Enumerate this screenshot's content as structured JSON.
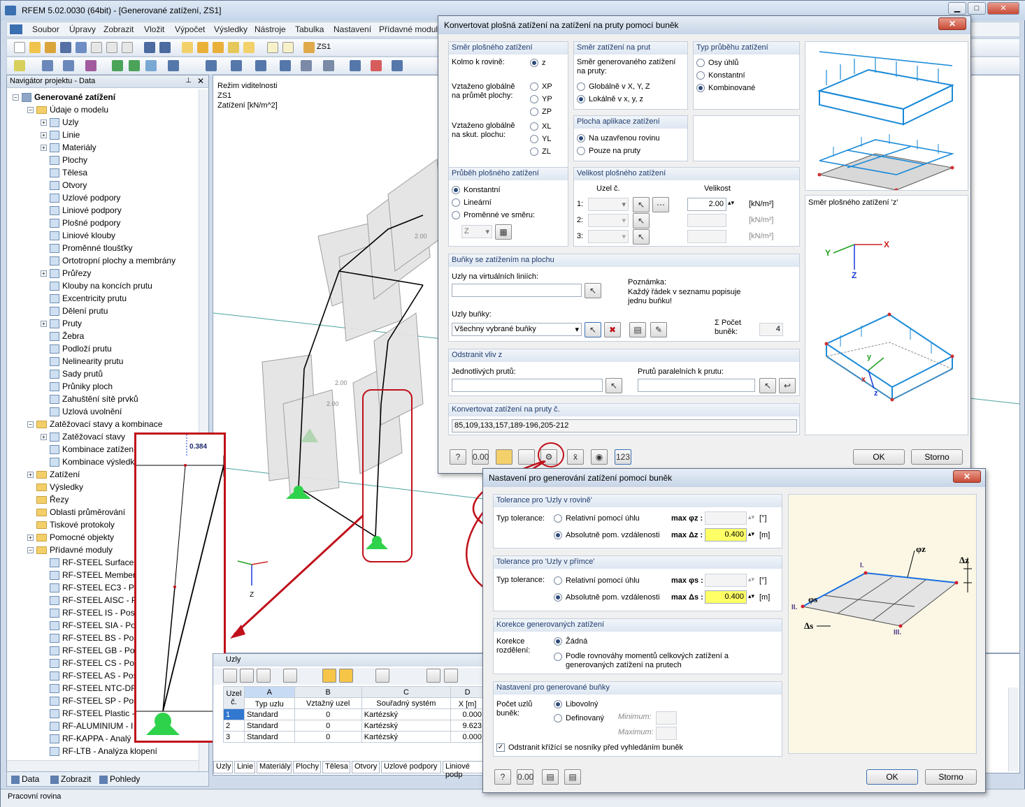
{
  "app": {
    "title": "RFEM 5.02.0030 (64bit) - [Generované zatížení, ZS1]"
  },
  "menu": [
    "Soubor",
    "Úpravy",
    "Zobrazit",
    "Vložit",
    "Výpočet",
    "Výsledky",
    "Nástroje",
    "Tabulka",
    "Nastavení",
    "Přídavné moduly"
  ],
  "toolbar": {
    "loadcase": "ZS1"
  },
  "navigator": {
    "title": "Navigátor projektu - Data",
    "root": "Generované zatížení",
    "items": [
      "Údaje o modelu",
      "Uzly",
      "Linie",
      "Materiály",
      "Plochy",
      "Tělesa",
      "Otvory",
      "Uzlové podpory",
      "Liniové podpory",
      "Plošné podpory",
      "Liniové klouby",
      "Proměnné tloušťky",
      "Ortotropní plochy a membrány",
      "Průřezy",
      "Klouby na koncích prutu",
      "Excentricity prutu",
      "Dělení prutu",
      "Pruty",
      "Žebra",
      "Podloží prutu",
      "Nelinearity prutu",
      "Sady prutů",
      "Průniky ploch",
      "Zahuštění sítě prvků",
      "Uzlová uvolnění",
      "Zatěžovací stavy a kombinace",
      "Zatěžovací stavy",
      "Kombinace zatížení",
      "Kombinace výsledků",
      "Zatížení",
      "Výsledky",
      "Řezy",
      "Oblasti průměrování",
      "Tiskové protokoly",
      "Pomocné objekty",
      "Přídavné moduly",
      "RF-STEEL Surfaces",
      "RF-STEEL Members",
      "RF-STEEL EC3 - Po",
      "RF-STEEL AISC - Po",
      "RF-STEEL IS - Poso",
      "RF-STEEL SIA - Pos",
      "RF-STEEL BS - Poso",
      "RF-STEEL GB - Pos",
      "RF-STEEL CS - Pose",
      "RF-STEEL AS - Pose",
      "RF-STEEL NTC-DF",
      "RF-STEEL SP - Poso",
      "RF-STEEL Plastic -",
      "RF-ALUMINIUM - I",
      "RF-KAPPA - Analý",
      "RF-LTB - Analýza klopení"
    ],
    "tabs": [
      "Data",
      "Zobrazit",
      "Pohledy"
    ]
  },
  "status": {
    "left": "Pracovní rovina"
  },
  "viewport": {
    "info": [
      "Režim viditelnosti",
      "ZS1",
      "Zatížení [kN/m^2]"
    ],
    "zoom_value": "0.384",
    "axis_z": "Z",
    "load_labels": [
      "2.00",
      "2.00",
      "2.00"
    ]
  },
  "table": {
    "title": "Uzly",
    "columns": [
      "A",
      "B",
      "C",
      "D"
    ],
    "headers": [
      "Uzel č.",
      "Typ uzlu",
      "Vztažný uzel",
      "Souřadný systém",
      "X [m]"
    ],
    "rows": [
      {
        "n": "1",
        "type": "Standard",
        "ref": "0",
        "cs": "Kartézský",
        "x": "0.000"
      },
      {
        "n": "2",
        "type": "Standard",
        "ref": "0",
        "cs": "Kartézský",
        "x": "9.623"
      },
      {
        "n": "3",
        "type": "Standard",
        "ref": "0",
        "cs": "Kartézský",
        "x": "0.000"
      }
    ],
    "tabs": [
      "Uzly",
      "Linie",
      "Materiály",
      "Plochy",
      "Tělesa",
      "Otvory",
      "Uzlové podpory",
      "Liniové podp"
    ]
  },
  "dialog1": {
    "title": "Konvertovat plošná zatížení na zatížení na pruty pomocí buněk",
    "dir_group": "Směr plošného zatížení",
    "dir_perp": "Kolmo k rovině:",
    "dir_z": "z",
    "dir_global_proj": "Vztaženo globálně na průmět plochy:",
    "dir_xp": "XP",
    "dir_yp": "YP",
    "dir_zp": "ZP",
    "dir_global_true": "Vztaženo globálně na skut. plochu:",
    "dir_xl": "XL",
    "dir_yl": "YL",
    "dir_zl": "ZL",
    "member_dir_group": "Směr zatížení na prut",
    "member_dir_text": "Směr generovaného zatížení na pruty:",
    "member_global": "Globálně v X, Y, Z",
    "member_local": "Lokálně v x, y, z",
    "type_group": "Typ průběhu zatížení",
    "type_axes": "Osy úhlů",
    "type_const": "Konstantní",
    "type_comb": "Kombinované",
    "area_group": "Plocha aplikace zatížení",
    "area_closed": "Na uzavřenou rovinu",
    "area_members": "Pouze na pruty",
    "dist_group": "Průběh plošného zatížení",
    "dist_const": "Konstantní",
    "dist_linear": "Lineární",
    "dist_var": "Proměnné ve směru:",
    "dist_dir": "Z",
    "mag_group": "Velikost plošného zatížení",
    "mag_node": "Uzel č.",
    "mag_size": "Velikost",
    "mag_row1": "1:",
    "mag_row2": "2:",
    "mag_row3": "3:",
    "mag_value": "2.00",
    "mag_unit": "[kN/m²]",
    "cells_group": "Buňky se zatížením na plochu",
    "cells_virtual": "Uzly na virtuálních liniích:",
    "cells_note_title": "Poznámka:",
    "cells_note": "Každý řádek v seznamu popisuje jednu buňku!",
    "cells_nodes": "Uzly buňky:",
    "cells_select": "Všechny vybrané buňky",
    "cells_count_label": "Σ Počet buněk:",
    "cells_count": "4",
    "remove_group": "Odstranit vliv z",
    "remove_single": "Jednotlivých prutů:",
    "remove_parallel": "Prutů paralelních k prutu:",
    "convert_group": "Konvertovat zatížení na pruty č.",
    "convert_list": "85,109,133,157,189-196,205-212",
    "preview_caption": "Směr plošného zatížení 'z'",
    "ok": "OK",
    "cancel": "Storno"
  },
  "dialog2": {
    "title": "Nastavení pro generování zatížení pomocí buněk",
    "plane_group": "Tolerance pro 'Uzly v rovině'",
    "tol_type": "Typ tolerance:",
    "relative_angle": "Relativní pomocí úhlu",
    "absolute_dist": "Absolutně pom. vzdálenosti",
    "max_phi_z": "max φz :",
    "max_dz": "max Δz :",
    "unit_deg": "[°]",
    "unit_m": "[m]",
    "plane_value": "0.400",
    "line_group": "Tolerance pro 'Uzly v přímce'",
    "max_phi_s": "max φs :",
    "max_ds": "max Δs :",
    "line_value": "0.400",
    "corr_group": "Korekce generovaných zatížení",
    "corr_label": "Korekce rozdělení:",
    "corr_none": "Žádná",
    "corr_equil": "Podle rovnováhy momentů celkových zatížení a generovaných zatížení na prutech",
    "cells_group": "Nastavení pro generované buňky",
    "cells_count": "Počet uzlů buněk:",
    "cells_any": "Libovolný",
    "cells_defined": "Definovaný",
    "cells_min": "Minimum:",
    "cells_max": "Maximum:",
    "cells_remove": "Odstranit křížící se nosníky před vyhledáním buněk",
    "ok": "OK",
    "cancel": "Storno",
    "diagram_labels": [
      "I.",
      "II.",
      "III.",
      "φz",
      "Δz",
      "φs",
      "Δs"
    ]
  },
  "colors": {
    "highlight": "#ffff66",
    "callout": "#c0101a",
    "accent": "#2c4a7a"
  }
}
